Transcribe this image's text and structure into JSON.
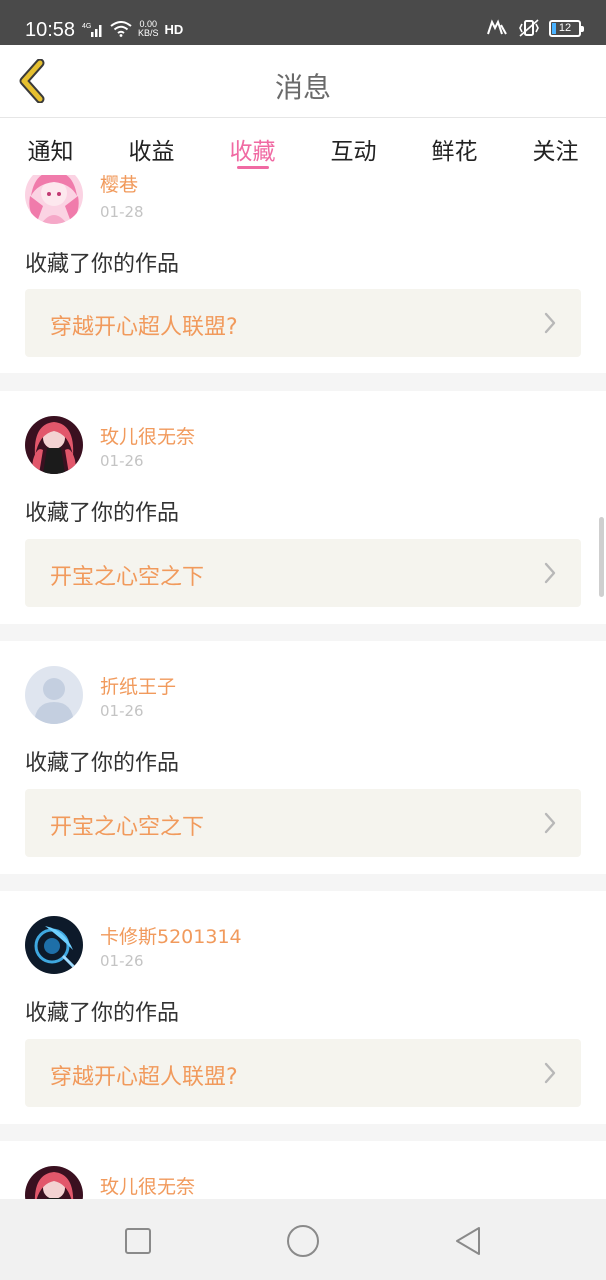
{
  "status_bar": {
    "time": "10:58",
    "signal": "4G",
    "net_speed_value": "0.00",
    "net_speed_unit": "KB/S",
    "hd": "HD",
    "battery": "12"
  },
  "header": {
    "title": "消息"
  },
  "tabs": [
    {
      "label": "通知"
    },
    {
      "label": "收益"
    },
    {
      "label": "收藏",
      "active": true
    },
    {
      "label": "互动"
    },
    {
      "label": "鲜花"
    },
    {
      "label": "关注"
    }
  ],
  "items": [
    {
      "username": "樱巷",
      "date": "01-28",
      "action": "收藏了你的作品",
      "work": "穿越开心超人联盟?",
      "avatar": "pink-anime-avatar"
    },
    {
      "username": "玫儿很无奈",
      "date": "01-26",
      "action": "收藏了你的作品",
      "work": "开宝之心空之下",
      "avatar": "red-anime-avatar"
    },
    {
      "username": "折纸王子",
      "date": "01-26",
      "action": "收藏了你的作品",
      "work": "开宝之心空之下",
      "avatar": "default-avatar"
    },
    {
      "username": "卡修斯5201314",
      "date": "01-26",
      "action": "收藏了你的作品",
      "work": "穿越开心超人联盟?",
      "avatar": "blue-dark-avatar"
    },
    {
      "username": "玫儿很无奈",
      "date": "",
      "action": "",
      "work": "",
      "avatar": "red-anime-avatar"
    }
  ],
  "colors": {
    "accent_pink": "#f06aa3",
    "username_orange": "#f19a5c",
    "back_arrow": "#e6c030",
    "work_bg": "#f5f4ee"
  }
}
